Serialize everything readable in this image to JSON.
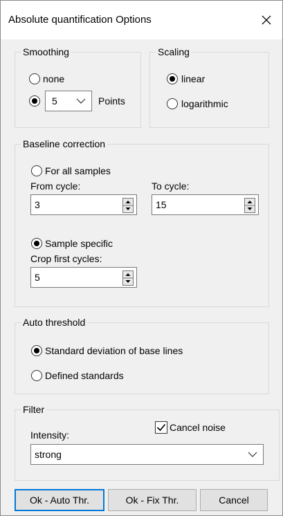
{
  "window": {
    "title": "Absolute quantification Options"
  },
  "smoothing": {
    "legend": "Smoothing",
    "none_label": "none",
    "points_value": "5",
    "points_label": "Points",
    "selected": "points"
  },
  "scaling": {
    "legend": "Scaling",
    "linear_label": "linear",
    "log_label": "logarithmic",
    "selected": "linear"
  },
  "baseline": {
    "legend": "Baseline correction",
    "all_samples_label": "For all samples",
    "from_label": "From cycle:",
    "from_value": "3",
    "to_label": "To cycle:",
    "to_value": "15",
    "specific_label": "Sample specific",
    "crop_label": "Crop first cycles:",
    "crop_value": "5",
    "selected": "sample_specific"
  },
  "threshold": {
    "legend": "Auto threshold",
    "stddev_label": "Standard deviation of base lines",
    "defined_label": "Defined standards",
    "selected": "stddev"
  },
  "filter": {
    "legend": "Filter",
    "cancel_noise_label": "Cancel noise",
    "cancel_noise_checked": true,
    "intensity_label": "Intensity:",
    "intensity_value": "strong"
  },
  "buttons": {
    "ok_auto": "Ok - Auto Thr.",
    "ok_fix": "Ok - Fix Thr.",
    "cancel": "Cancel"
  }
}
